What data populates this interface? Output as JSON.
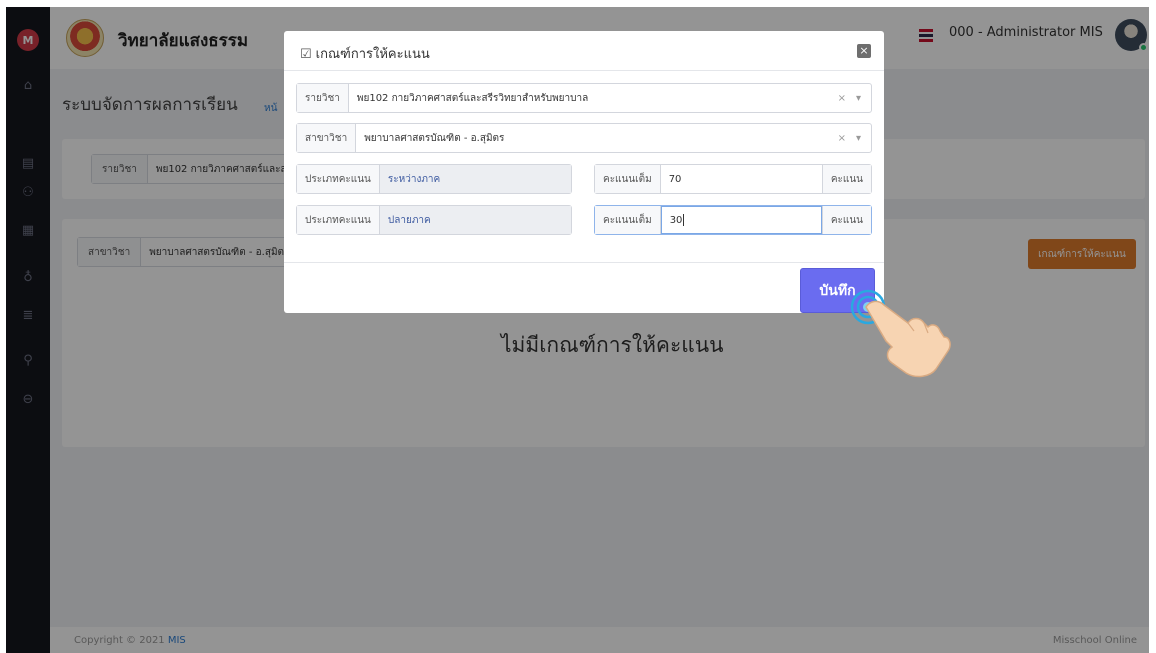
{
  "sidebar": {
    "logo_letter": "M",
    "icons": [
      "home-icon",
      "document-icon",
      "group-icon",
      "calendar-icon",
      "user-add-icon",
      "book-icon",
      "users-icon",
      "logout-icon"
    ]
  },
  "topbar": {
    "school_name": "วิทยาลัยแสงธรรม",
    "user_label": "000 - Administrator MIS",
    "flag_colors": [
      "#c8102e",
      "#ffffff",
      "#2d2a4a"
    ]
  },
  "page": {
    "title": "ระบบจัดการผลการเรียน",
    "breadcrumb": "หน้"
  },
  "filters": {
    "subject_label": "รายวิชา",
    "subject_value": "พย102 กายวิภาคศาสตร์และสรี",
    "major_label": "สาขาวิชา",
    "major_value": "พยาบาลศาสตรบัณฑิต - อ.สุมิตร"
  },
  "content": {
    "criteria_button": "เกณฑ์การให้คะแนน",
    "empty_message": "ไม่มีเกณฑ์การให้คะแนน"
  },
  "footer": {
    "copyright_prefix": "Copyright © 2021",
    "copyright_brand": "MIS",
    "right_text": "Misschool Online"
  },
  "modal": {
    "title": "เกณฑ์การให้คะแนน",
    "close_symbol": "×",
    "subject_label": "รายวิชา",
    "subject_value": "พย102 กายวิภาคศาสตร์และสรีรวิทยาสำหรับพยาบาล",
    "major_label": "สาขาวิชา",
    "major_value": "พยาบาลศาสตรบัณฑิต - อ.สุมิตร",
    "clear_symbol": "×",
    "dropdown_symbol": "▾",
    "rows": [
      {
        "type_label": "ประเภทคะแนน",
        "type_value": "ระหว่างภาค",
        "score_label": "คะแนนเต็ม",
        "score_value": "70",
        "unit": "คะแนน"
      },
      {
        "type_label": "ประเภทคะแนน",
        "type_value": "ปลายภาค",
        "score_label": "คะแนนเต็ม",
        "score_value": "30",
        "unit": "คะแนน"
      }
    ],
    "save_label": "บันทึก"
  }
}
